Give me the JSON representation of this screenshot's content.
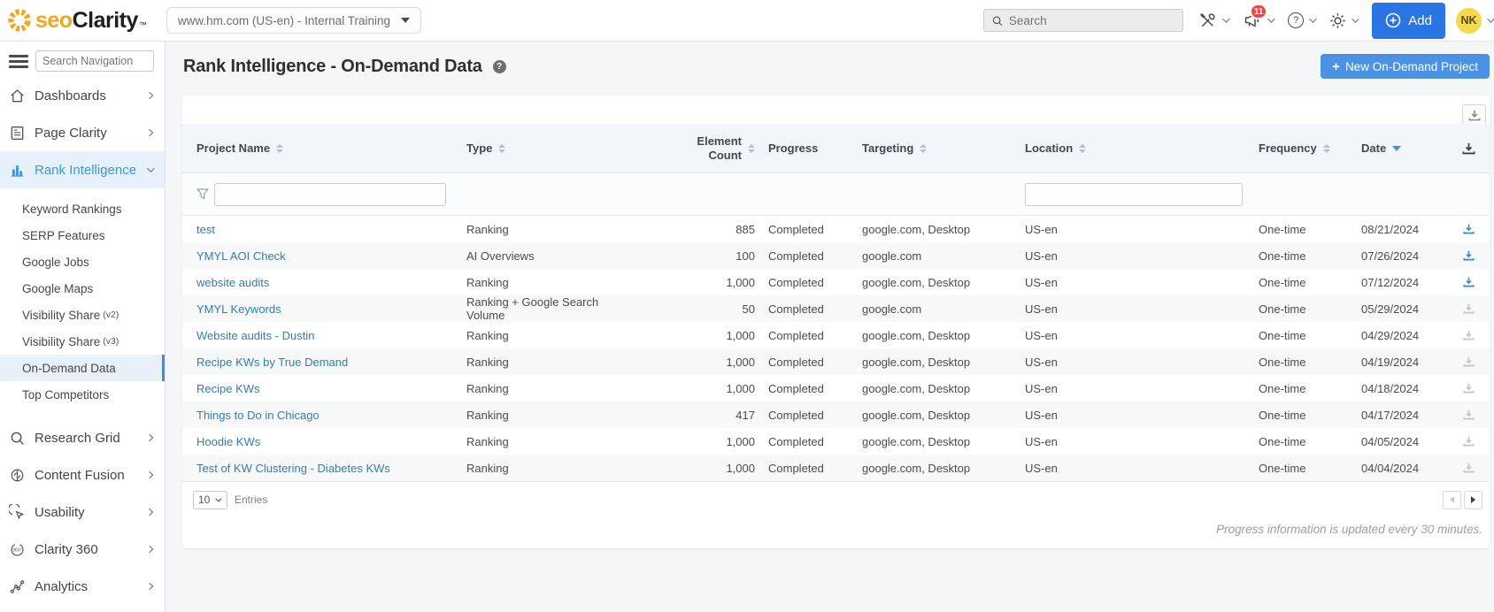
{
  "colors": {
    "accent_blue": "#3d8fdd",
    "link_blue": "#2e7dc2",
    "badge_red": "#ef4649",
    "brand_yellow": "#f0a71c",
    "button_blue": "#2a74e4"
  },
  "header": {
    "brand": {
      "seo": "seo",
      "clarity": "Clarity",
      "tm": "™"
    },
    "domain_selector": {
      "label": "www.hm.com (US-en) - Internal Training"
    },
    "search": {
      "placeholder": "Search"
    },
    "notifications": {
      "badge": "11"
    },
    "add_button": {
      "label": "Add"
    },
    "avatar": {
      "initials": "NK"
    }
  },
  "sidebar": {
    "search": {
      "placeholder": "Search Navigation"
    },
    "items": [
      {
        "label": "Dashboards"
      },
      {
        "label": "Page Clarity"
      },
      {
        "label": "Rank Intelligence"
      },
      {
        "label": "Research Grid"
      },
      {
        "label": "Content Fusion"
      },
      {
        "label": "Usability"
      },
      {
        "label": "Clarity 360"
      },
      {
        "label": "Analytics"
      }
    ],
    "rank_intelligence_children": [
      {
        "label": "Keyword Rankings"
      },
      {
        "label": "SERP Features"
      },
      {
        "label": "Google Jobs"
      },
      {
        "label": "Google Maps"
      },
      {
        "label": "Visibility Share",
        "suffix": "(v2)"
      },
      {
        "label": "Visibility Share",
        "suffix": "(v3)"
      },
      {
        "label": "On-Demand Data",
        "active": true
      },
      {
        "label": "Top Competitors"
      }
    ]
  },
  "page": {
    "title": "Rank Intelligence - On-Demand Data",
    "new_project_button": "New On-Demand Project"
  },
  "table": {
    "headers": [
      {
        "label": "Project Name",
        "sort": "both"
      },
      {
        "label": "Type",
        "sort": "both"
      },
      {
        "label": "Element Count",
        "sort": "both"
      },
      {
        "label": "Progress",
        "sort": "none"
      },
      {
        "label": "Targeting",
        "sort": "both"
      },
      {
        "label": "Location",
        "sort": "both"
      },
      {
        "label": "Frequency",
        "sort": "both"
      },
      {
        "label": "Date",
        "sort": "desc"
      }
    ],
    "rows": [
      {
        "project_name": "test",
        "type": "Ranking",
        "element_count": "885",
        "progress": "Completed",
        "targeting": "google.com, Desktop",
        "location": "US-en",
        "frequency": "One-time",
        "date": "08/21/2024",
        "download_enabled": true
      },
      {
        "project_name": "YMYL AOI Check",
        "type": "AI Overviews",
        "element_count": "100",
        "progress": "Completed",
        "targeting": "google.com",
        "location": "US-en",
        "frequency": "One-time",
        "date": "07/26/2024",
        "download_enabled": true
      },
      {
        "project_name": "website audits",
        "type": "Ranking",
        "element_count": "1,000",
        "progress": "Completed",
        "targeting": "google.com, Desktop",
        "location": "US-en",
        "frequency": "One-time",
        "date": "07/12/2024",
        "download_enabled": true
      },
      {
        "project_name": "YMYL Keywords",
        "type": "Ranking + Google Search Volume",
        "element_count": "50",
        "progress": "Completed",
        "targeting": "google.com",
        "location": "US-en",
        "frequency": "One-time",
        "date": "05/29/2024",
        "download_enabled": false
      },
      {
        "project_name": "Website audits - Dustin",
        "type": "Ranking",
        "element_count": "1,000",
        "progress": "Completed",
        "targeting": "google.com, Desktop",
        "location": "US-en",
        "frequency": "One-time",
        "date": "04/29/2024",
        "download_enabled": false
      },
      {
        "project_name": "Recipe KWs by True Demand",
        "type": "Ranking",
        "element_count": "1,000",
        "progress": "Completed",
        "targeting": "google.com, Desktop",
        "location": "US-en",
        "frequency": "One-time",
        "date": "04/19/2024",
        "download_enabled": false
      },
      {
        "project_name": "Recipe KWs",
        "type": "Ranking",
        "element_count": "1,000",
        "progress": "Completed",
        "targeting": "google.com, Desktop",
        "location": "US-en",
        "frequency": "One-time",
        "date": "04/18/2024",
        "download_enabled": false
      },
      {
        "project_name": "Things to Do in Chicago",
        "type": "Ranking",
        "element_count": "417",
        "progress": "Completed",
        "targeting": "google.com, Desktop",
        "location": "US-en",
        "frequency": "One-time",
        "date": "04/17/2024",
        "download_enabled": false
      },
      {
        "project_name": "Hoodie KWs",
        "type": "Ranking",
        "element_count": "1,000",
        "progress": "Completed",
        "targeting": "google.com, Desktop",
        "location": "US-en",
        "frequency": "One-time",
        "date": "04/05/2024",
        "download_enabled": false
      },
      {
        "project_name": "Test of KW Clustering - Diabetes KWs",
        "type": "Ranking",
        "element_count": "1,000",
        "progress": "Completed",
        "targeting": "google.com, Desktop",
        "location": "US-en",
        "frequency": "One-time",
        "date": "04/04/2024",
        "download_enabled": false
      }
    ]
  },
  "pager": {
    "entries_value": "10",
    "entries_label": "Entries"
  },
  "note": "Progress information is updated every 30 minutes."
}
